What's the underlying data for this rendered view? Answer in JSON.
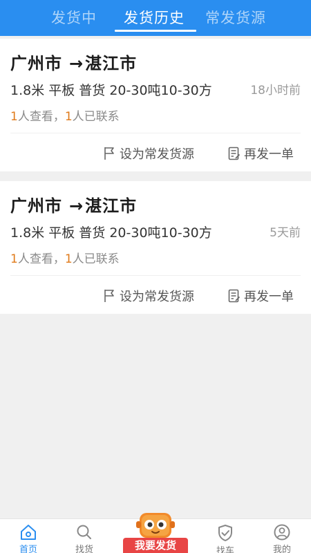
{
  "tabs": [
    {
      "label": "发货中"
    },
    {
      "label": "发货历史"
    },
    {
      "label": "常发货源"
    }
  ],
  "orders": [
    {
      "origin": "广州市",
      "arrow": "→",
      "destination": "湛江市",
      "detail": "1.8米 平板 普货 20-30吨10-30方",
      "time": "18小时前",
      "viewed_count": "1",
      "viewed_text": "人查看，",
      "contacted_count": "1",
      "contacted_text": "人已联系",
      "action_favorite": "设为常发货源",
      "action_repost": "再发一单"
    },
    {
      "origin": "广州市",
      "arrow": "→",
      "destination": "湛江市",
      "detail": "1.8米 平板 普货 20-30吨10-30方",
      "time": "5天前",
      "viewed_count": "1",
      "viewed_text": "人查看，",
      "contacted_count": "1",
      "contacted_text": "人已联系",
      "action_favorite": "设为常发货源",
      "action_repost": "再发一单"
    }
  ],
  "bottom_nav": {
    "home": {
      "label": "首页",
      "icon": "home-icon"
    },
    "find_cargo": {
      "label": "找货",
      "icon": "search-icon"
    },
    "publish": {
      "label": "我要发货",
      "icon": "mascot-icon"
    },
    "find_truck": {
      "label": "找车",
      "icon": "shield-check-icon"
    },
    "mine": {
      "label": "我的",
      "icon": "user-icon"
    }
  },
  "colors": {
    "primary": "#2a8ef0",
    "count_highlight": "#e07a1a",
    "publish_button": "#e84545"
  }
}
